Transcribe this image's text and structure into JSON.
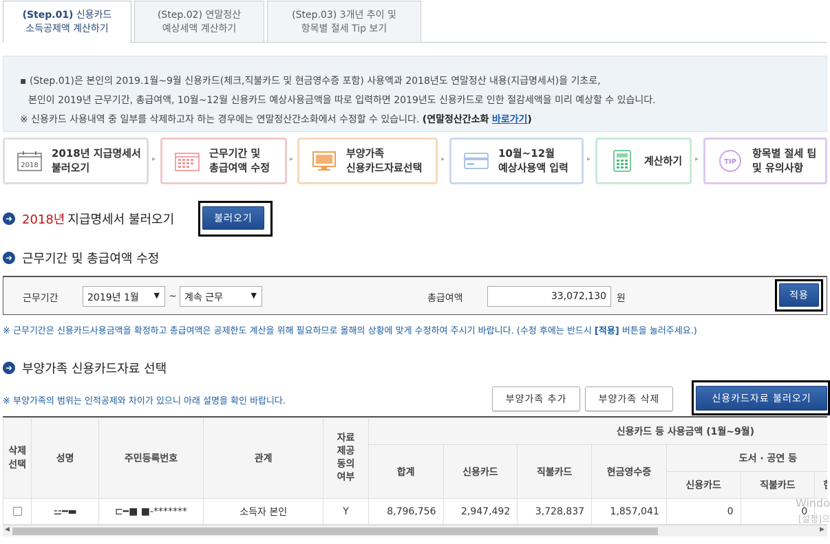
{
  "tabs": [
    {
      "step": "(Step.01)",
      "line1": "신용카드",
      "line2": "소득공제액 계산하기"
    },
    {
      "step": "(Step.02)",
      "line1": "연말정산",
      "line2": "예상세액 계산하기"
    },
    {
      "step": "(Step.03)",
      "line1": "3개년 추이 및",
      "line2": "항목별 절세 Tip 보기"
    }
  ],
  "info": {
    "line1": "▪ (Step.01)은 본인의 2019.1월~9월 신용카드(체크,직불카드 및 현금영수증 포함) 사용액과 2018년도 연말정산 내용(지급명세서)을 기초로,",
    "line2": "본인이 2019년 근무기간, 총급여액, 10월~12월 신용카드 예상사용금액을 따로 입력하면 2019년도 신용카드로 인한 절감세액을 미리 예상할 수 있습니다.",
    "line3_text": "※ 신용카드 사용내역 중 일부를 삭제하고자 하는 경우에는 연말정산간소화에서 수정할 수 있습니다.",
    "line3_open": "(연말정산간소화",
    "line3_link": "바로가기",
    "line3_close": ")"
  },
  "steps": [
    {
      "icon": "calendar-2018-icon",
      "icon_text": "2018",
      "label": "2018년 지급명세서\n불러오기"
    },
    {
      "icon": "calendar-grid-icon",
      "label": "근무기간 및\n총급여액 수정"
    },
    {
      "icon": "monitor-icon",
      "label": "부양가족\n신용카드자료선택"
    },
    {
      "icon": "credit-card-icon",
      "label": "10월~12월\n예상사용액 입력"
    },
    {
      "icon": "calculator-icon",
      "label": "계산하기"
    },
    {
      "icon": "tip-icon",
      "icon_text": "TIP",
      "label": "항목별 절세 팁\n및 유의사항"
    }
  ],
  "section1": {
    "year": "2018년",
    "title": "지급명세서 불러오기",
    "button": "불러오기"
  },
  "section2": {
    "title": "근무기간 및 총급여액 수정",
    "period_label": "근무기간",
    "period_start": "2019년 1월",
    "tilde": "~",
    "period_end": "계속 근무",
    "salary_label": "총급여액",
    "salary_value": "33,072,130",
    "unit": "원",
    "apply": "적용",
    "note_before": "※ 근무기간은 신용카드사용금액을 확정하고 총급여액은 공제한도 계산을 위해 필요하므로 올해의 상황에 맞게 수정하여 주시기 바랍니다. (수정 후에는 반드시 ",
    "note_bold": "[적용]",
    "note_after": " 버튼을 눌러주세요.)"
  },
  "section3": {
    "title": "부양가족 신용카드자료 선택",
    "note": "※ 부양가족의 범위는 인적공제와 차이가 있으니 아래 설명을 확인 바랍니다.",
    "add": "부양가족 추가",
    "delete": "부양가족 삭제",
    "load": "신용카드자료 불러오기"
  },
  "table": {
    "h_delete": "삭제\n선택",
    "h_name": "성명",
    "h_id": "주민등록번호",
    "h_rel": "관계",
    "h_consent": "자료\n제공\n동의\n여부",
    "h_group": "신용카드 등 사용금액 (1월~9월)",
    "h_total": "합계",
    "h_credit": "신용카드",
    "h_debit": "직불카드",
    "h_cash": "현금영수증",
    "h_culture": "도서 · 공연 등",
    "h_c_credit": "신용카드",
    "h_c_debit": "직불카드",
    "h_c_cash": "현",
    "row": {
      "name": "⚍━▬",
      "id": "⊏━■  ■-*******",
      "relation": "소득자 본인",
      "consent": "Y",
      "total": "8,796,756",
      "credit": "2,947,492",
      "debit": "3,728,837",
      "cash": "1,857,041",
      "c_credit": "0",
      "c_debit": "0"
    }
  },
  "watermark": {
    "line1": "Windo",
    "line2": "[설정]으"
  }
}
